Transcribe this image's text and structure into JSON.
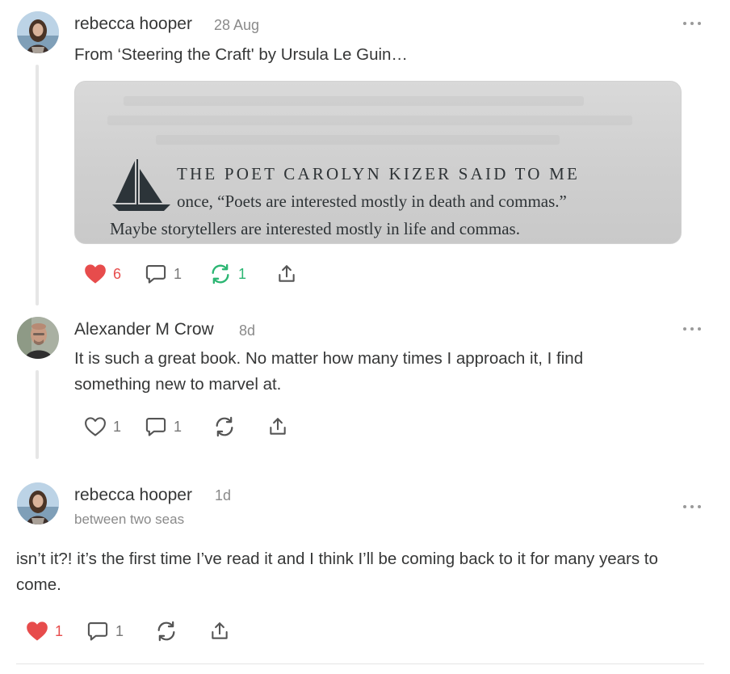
{
  "post1": {
    "author": "rebecca hooper",
    "time": "28 Aug",
    "text": "From ‘Steering the Craft' by Ursula Le Guin…",
    "quote_image": {
      "line1": "THE POET CAROLYN KIZER SAID TO ME",
      "line2": "once, “Poets are interested mostly in death and commas.”",
      "line3": "Maybe storytellers are interested mostly in life and commas."
    },
    "likes": "6",
    "comments": "1",
    "restacks": "1"
  },
  "post2": {
    "author": "Alexander M Crow",
    "time": "8d",
    "text": "It is such a great book. No matter how many times I approach it, I find something new to marvel at.",
    "likes": "1",
    "comments": "1"
  },
  "post3": {
    "author": "rebecca hooper",
    "time": "1d",
    "subtitle": "between two seas",
    "text": "isn’t it?! it’s the first time I’ve read it and I think I’ll be coming back to it for many years to come.",
    "likes": "1",
    "comments": "1"
  },
  "colors": {
    "heart_red": "#e74c4c",
    "restack_green": "#2cb673",
    "text": "#363737",
    "muted": "#8a8a8a"
  },
  "icons": [
    "heart-icon",
    "comment-icon",
    "restack-icon",
    "share-icon",
    "more-icon"
  ]
}
